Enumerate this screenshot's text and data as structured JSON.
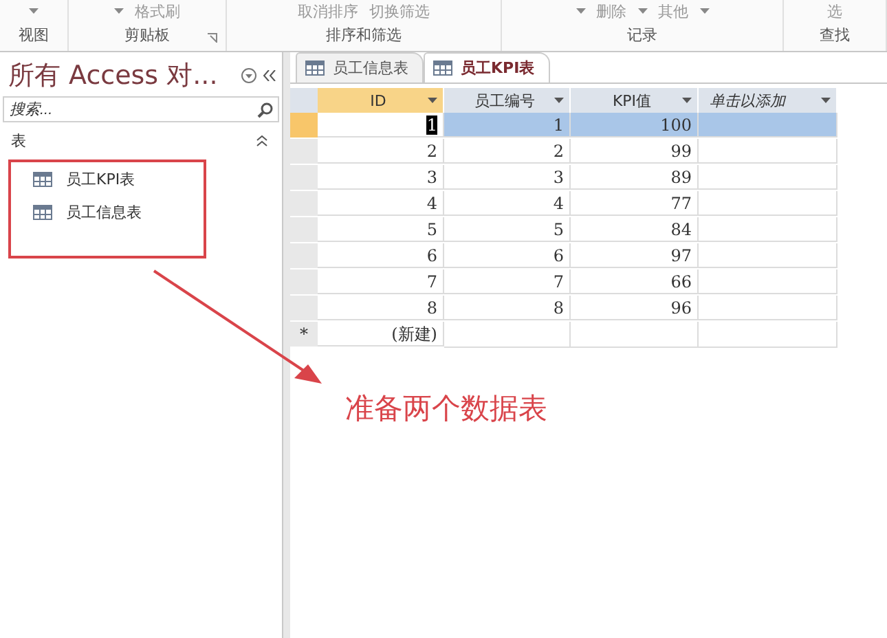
{
  "ribbon": {
    "groups": [
      {
        "label": "视图",
        "items": [
          {
            "kind": "caret"
          }
        ]
      },
      {
        "label": "剪贴板",
        "launcher": true,
        "items": [
          {
            "kind": "caret"
          },
          {
            "kind": "button",
            "label": "格式刷"
          }
        ]
      },
      {
        "label": "排序和筛选",
        "items": [
          {
            "kind": "button",
            "label": "取消排序"
          },
          {
            "kind": "button",
            "label": "切换筛选"
          }
        ]
      },
      {
        "label": "记录",
        "items": [
          {
            "kind": "caret"
          },
          {
            "kind": "button",
            "label": "删除"
          },
          {
            "kind": "caret"
          },
          {
            "kind": "button",
            "label": "其他"
          },
          {
            "kind": "caret"
          }
        ]
      },
      {
        "label": "查找",
        "items": [
          {
            "kind": "button",
            "label": "选"
          }
        ]
      }
    ]
  },
  "nav_pane": {
    "title": "所有 Access 对...",
    "search": {
      "placeholder": "搜索..."
    },
    "section": {
      "label": "表",
      "expanded": true,
      "items": [
        {
          "label": "员工KPI表"
        },
        {
          "label": "员工信息表"
        }
      ]
    }
  },
  "tabs": [
    {
      "label": "员工信息表",
      "selected": false
    },
    {
      "label": "员工KPI表",
      "selected": true
    }
  ],
  "table": {
    "columns": [
      {
        "label": "ID",
        "kind": "field"
      },
      {
        "label": "员工编号",
        "kind": "field"
      },
      {
        "label": "KPI值",
        "kind": "field"
      },
      {
        "label": "单击以添加",
        "kind": "add"
      }
    ],
    "rows": [
      {
        "cells": [
          "1",
          "1",
          "100"
        ],
        "selected": true
      },
      {
        "cells": [
          "2",
          "2",
          "99"
        ],
        "selected": false
      },
      {
        "cells": [
          "3",
          "3",
          "89"
        ],
        "selected": false
      },
      {
        "cells": [
          "4",
          "4",
          "77"
        ],
        "selected": false
      },
      {
        "cells": [
          "5",
          "5",
          "84"
        ],
        "selected": false
      },
      {
        "cells": [
          "6",
          "6",
          "97"
        ],
        "selected": false
      },
      {
        "cells": [
          "7",
          "7",
          "66"
        ],
        "selected": false
      },
      {
        "cells": [
          "8",
          "8",
          "96"
        ],
        "selected": false
      }
    ],
    "new_row": {
      "marker": "*",
      "label": "(新建)"
    }
  },
  "annotation": {
    "text": "准备两个数据表"
  }
}
